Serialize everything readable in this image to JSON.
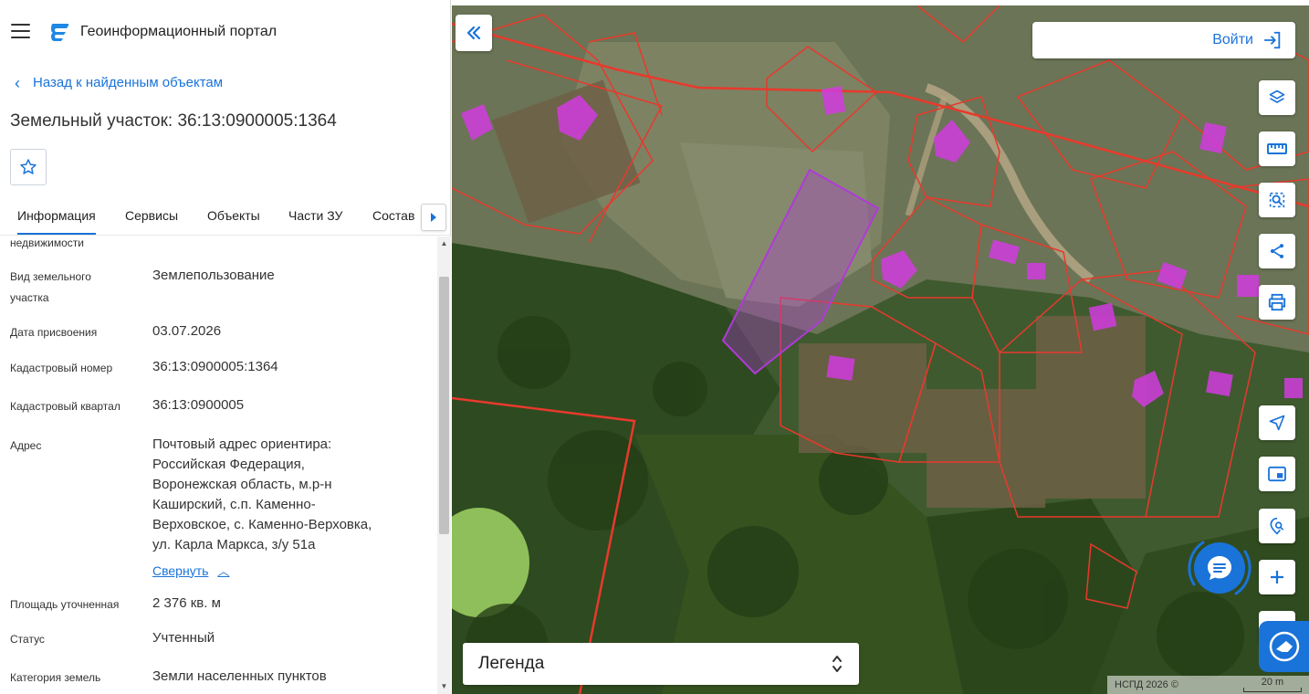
{
  "header": {
    "portal_title": "Геоинформационный портал"
  },
  "nav": {
    "back_label": "Назад к найденным объектам"
  },
  "object": {
    "title": "Земельный участок: 36:13:0900005:1364"
  },
  "tabs": [
    {
      "label": "Информация"
    },
    {
      "label": "Сервисы"
    },
    {
      "label": "Объекты"
    },
    {
      "label": "Части ЗУ"
    },
    {
      "label": "Состав"
    }
  ],
  "info": {
    "partial_label": "недвижимости",
    "rows": [
      {
        "label_lines": [
          "Вид земельного",
          "участка"
        ],
        "value": "Землепользование"
      },
      {
        "label": "Дата присвоения",
        "value": "03.07.2026"
      },
      {
        "label": "Кадастровый номер",
        "value": "36:13:0900005:1364"
      },
      {
        "label": "Кадастровый квартал",
        "value": "36:13:0900005"
      },
      {
        "label": "Адрес",
        "value_lines": [
          "Почтовый адрес ориентира:",
          "Российская Федерация,",
          "Воронежская область, м.р-н",
          "Каширский, с.п. Каменно-",
          "Верховское, с. Каменно-Верховка,",
          "ул. Карла Маркса, з/у 51а"
        ]
      },
      {
        "label": "Площадь уточненная",
        "value": "2 376 кв. м"
      },
      {
        "label": "Статус",
        "value": "Учтенный"
      },
      {
        "label": "Категория земель",
        "value": "Земли населенных пунктов"
      }
    ],
    "collapse_label": "Свернуть"
  },
  "map": {
    "login_label": "Войти",
    "legend_label": "Легенда",
    "attribution": "НСПД 2026 ©",
    "scale_label": "20 m",
    "tools": [
      "layers-icon",
      "ruler-icon",
      "select-area-icon",
      "share-icon",
      "print-icon",
      "navigation-icon",
      "minimap-icon",
      "location-search-icon",
      "zoom-in-icon",
      "zoom-out-icon"
    ],
    "colors": {
      "parcel_border": "#e8392c",
      "selected_parcel": "#b03ad8",
      "building": "#d23be0",
      "accent": "#1a73d9"
    }
  }
}
